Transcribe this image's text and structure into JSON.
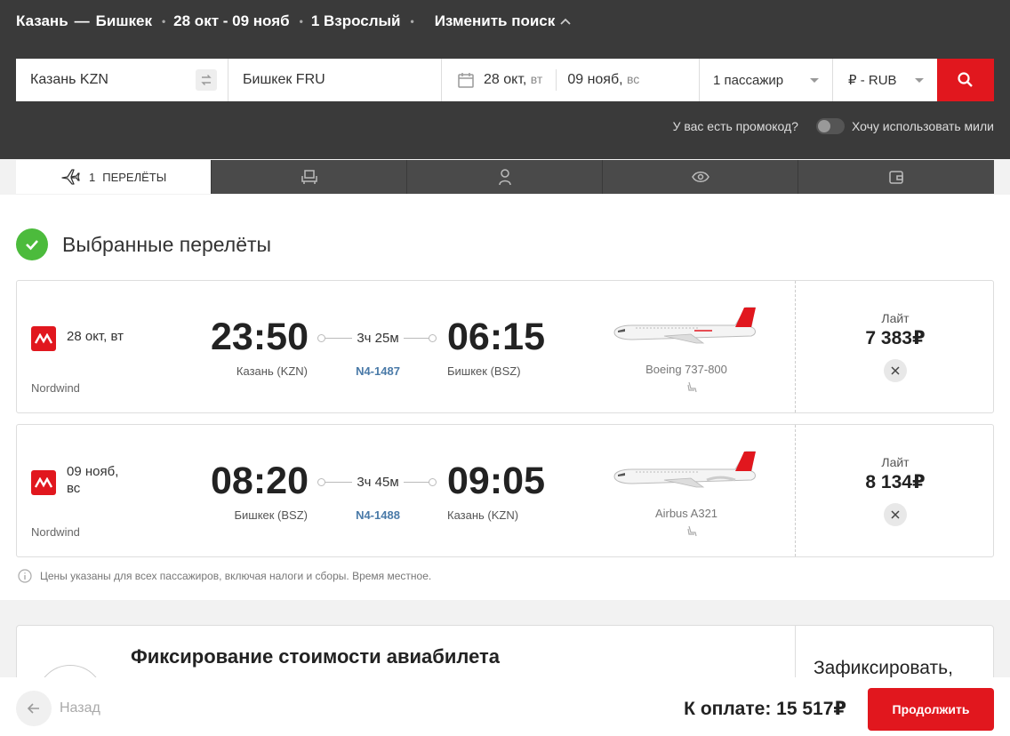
{
  "header": {
    "route_from": "Казань",
    "route_dash": "—",
    "route_to": "Бишкек",
    "dates": "28 окт - 09 нояб",
    "passengers": "1 Взрослый",
    "change_search": "Изменить поиск"
  },
  "search": {
    "from": "Казань KZN",
    "to": "Бишкек FRU",
    "depart_date": "28 окт,",
    "depart_weekday": "вт",
    "return_date": "09 нояб,",
    "return_weekday": "вс",
    "passengers": "1 пассажир",
    "currency": "₽ - RUB",
    "promo": "У вас есть промокод?",
    "miles": "Хочу использовать мили"
  },
  "steps": {
    "active_count": "1",
    "active_label": "ПЕРЕЛЁТЫ"
  },
  "selected": {
    "title": "Выбранные перелёты",
    "note": "Цены указаны для всех пассажиров, включая налоги и сборы. Время местное."
  },
  "flights": [
    {
      "date_line1": "28 окт, вт",
      "date_line2": "",
      "airline": "Nordwind",
      "dep_time": "23:50",
      "dep_city": "Казань (KZN)",
      "duration": "3ч 25м",
      "flight_no": "N4-1487",
      "arr_time": "06:15",
      "arr_city": "Бишкек (BSZ)",
      "aircraft": "Boeing 737-800",
      "fare": "Лайт",
      "price": "7 383₽"
    },
    {
      "date_line1": "09 нояб,",
      "date_line2": "вс",
      "airline": "Nordwind",
      "dep_time": "08:20",
      "dep_city": "Бишкек (BSZ)",
      "duration": "3ч 45м",
      "flight_no": "N4-1488",
      "arr_time": "09:05",
      "arr_city": "Казань (KZN)",
      "aircraft": "Airbus A321",
      "fare": "Лайт",
      "price": "8 134₽"
    }
  ],
  "fix": {
    "title": "Фиксирование стоимости авиабилета",
    "action": "Зафиксировать,"
  },
  "footer": {
    "back": "Назад",
    "total": "К оплате:  15 517₽",
    "continue": "Продолжить"
  },
  "colors": {
    "brand_red": "#e1171e",
    "header_bg": "#3a3a3a",
    "success_green": "#4cbb3c",
    "link_blue": "#4a7aa8"
  }
}
